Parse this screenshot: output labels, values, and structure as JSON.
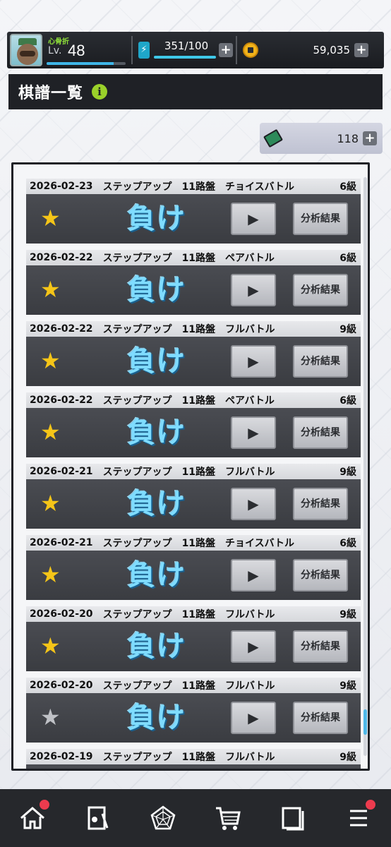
{
  "player": {
    "name": "心骨折",
    "level_prefix": "Lv.",
    "level": "48",
    "xp_fraction": 0.85
  },
  "energy": {
    "value": "351/100",
    "fill_fraction": 1.0
  },
  "coins": "59,035",
  "title": "棋譜一覧",
  "ticket_count": "118",
  "records": [
    {
      "date": "2026-02-23",
      "course": "ステップアップ",
      "board": "11路盤",
      "mode": "チョイスバトル",
      "rank": "6級",
      "result": "負け",
      "star": "gold",
      "play_label": "▶",
      "analysis_label": "分析結果"
    },
    {
      "date": "2026-02-22",
      "course": "ステップアップ",
      "board": "11路盤",
      "mode": "ペアバトル",
      "rank": "6級",
      "result": "負け",
      "star": "gold",
      "play_label": "▶",
      "analysis_label": "分析結果"
    },
    {
      "date": "2026-02-22",
      "course": "ステップアップ",
      "board": "11路盤",
      "mode": "フルバトル",
      "rank": "9級",
      "result": "負け",
      "star": "gold",
      "play_label": "▶",
      "analysis_label": "分析結果"
    },
    {
      "date": "2026-02-22",
      "course": "ステップアップ",
      "board": "11路盤",
      "mode": "ペアバトル",
      "rank": "6級",
      "result": "負け",
      "star": "gold",
      "play_label": "▶",
      "analysis_label": "分析結果"
    },
    {
      "date": "2026-02-21",
      "course": "ステップアップ",
      "board": "11路盤",
      "mode": "フルバトル",
      "rank": "9級",
      "result": "負け",
      "star": "gold",
      "play_label": "▶",
      "analysis_label": "分析結果"
    },
    {
      "date": "2026-02-21",
      "course": "ステップアップ",
      "board": "11路盤",
      "mode": "チョイスバトル",
      "rank": "6級",
      "result": "負け",
      "star": "gold",
      "play_label": "▶",
      "analysis_label": "分析結果"
    },
    {
      "date": "2026-02-20",
      "course": "ステップアップ",
      "board": "11路盤",
      "mode": "フルバトル",
      "rank": "9級",
      "result": "負け",
      "star": "gold",
      "play_label": "▶",
      "analysis_label": "分析結果"
    },
    {
      "date": "2026-02-20",
      "course": "ステップアップ",
      "board": "11路盤",
      "mode": "フルバトル",
      "rank": "9級",
      "result": "負け",
      "star": "gray",
      "play_label": "▶",
      "analysis_label": "分析結果"
    },
    {
      "date": "2026-02-19",
      "course": "ステップアップ",
      "board": "11路盤",
      "mode": "フルバトル",
      "rank": "9級",
      "result": "",
      "star": "",
      "play_label": "",
      "analysis_label": ""
    }
  ],
  "colors": {
    "star_gold": "#f5c518",
    "star_gray": "#bfc1c6",
    "badge": "#ec3b4e",
    "accent": "#3fb6e8"
  },
  "bottom_nav": [
    {
      "icon": "home-icon",
      "badge": true
    },
    {
      "icon": "record-icon",
      "badge": false
    },
    {
      "icon": "radar-chart-icon",
      "badge": false
    },
    {
      "icon": "shop-cart-icon",
      "badge": false
    },
    {
      "icon": "collection-icon",
      "badge": false
    },
    {
      "icon": "menu-icon",
      "badge": true
    }
  ]
}
